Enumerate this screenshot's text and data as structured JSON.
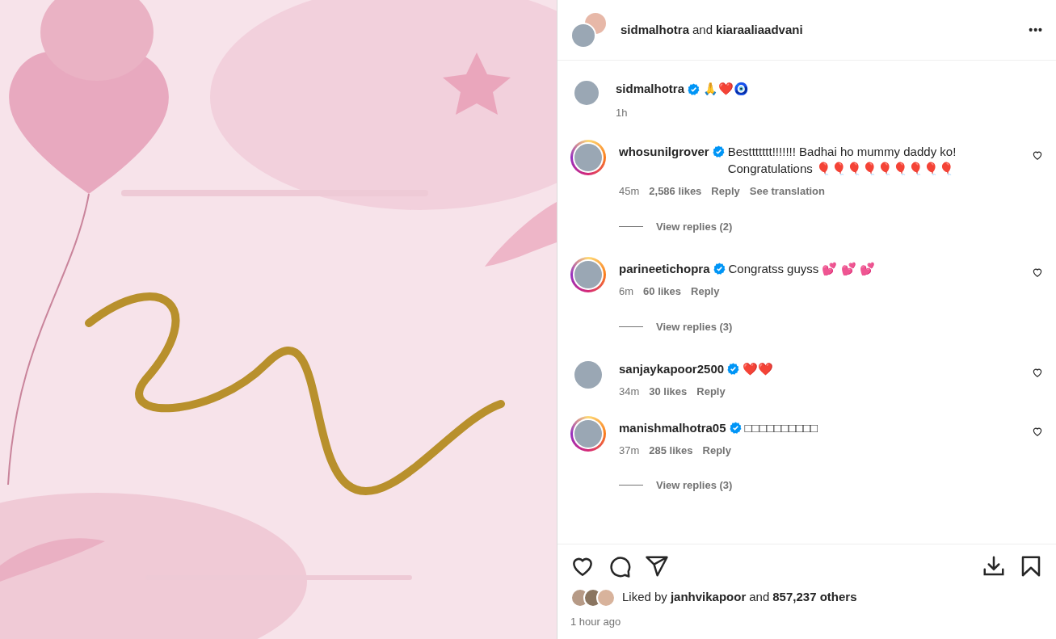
{
  "header": {
    "author": "sidmalhotra",
    "joiner": "and",
    "coauthor": "kiaraaliaadvani",
    "more": "•••"
  },
  "caption": {
    "user": "sidmalhotra",
    "verified": true,
    "text": "🙏❤️🧿",
    "time": "1h"
  },
  "comments": [
    {
      "user": "whosunilgrover",
      "verified": true,
      "story_ring": true,
      "text": "Besttttttt!!!!!!! Badhai ho mummy daddy ko! Congratulations 🎈🎈🎈🎈🎈🎈🎈🎈🎈",
      "time": "45m",
      "likes": "2,586 likes",
      "reply": "Reply",
      "translate": "See translation",
      "replies": "View replies (2)"
    },
    {
      "user": "parineetichopra",
      "verified": true,
      "story_ring": true,
      "text": "Congratss guyss 💕 💕 💕",
      "time": "6m",
      "likes": "60 likes",
      "reply": "Reply",
      "replies": "View replies (3)"
    },
    {
      "user": "sanjaykapoor2500",
      "verified": true,
      "story_ring": false,
      "text": "❤️❤️",
      "time": "34m",
      "likes": "30 likes",
      "reply": "Reply"
    },
    {
      "user": "manishmalhotra05",
      "verified": true,
      "story_ring": true,
      "text": "□□□□□□□□□□",
      "time": "37m",
      "likes": "285 likes",
      "reply": "Reply",
      "replies": "View replies (3)"
    }
  ],
  "likes": {
    "prefix": "Liked by",
    "user": "janhvikapoor",
    "joiner": "and",
    "others": "857,237 others"
  },
  "time": "1 hour ago"
}
